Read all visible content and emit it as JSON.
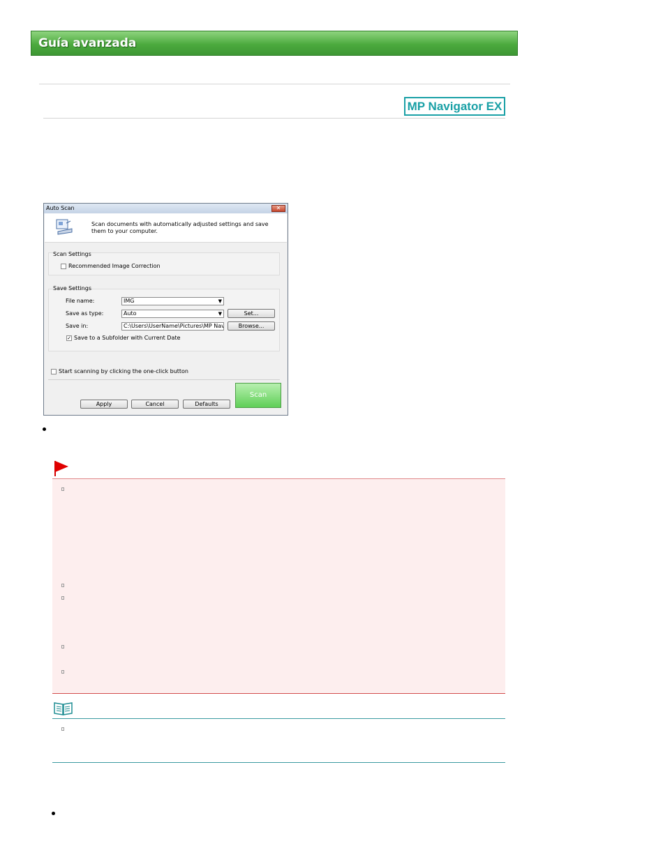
{
  "banner": {
    "title": "Guía avanzada"
  },
  "logo": {
    "text": "MP Navigator EX"
  },
  "dialog": {
    "title": "Auto Scan",
    "close_glyph": "✕",
    "description": "Scan documents with automatically adjusted settings and save them to your computer.",
    "scan_settings": {
      "label": "Scan Settings",
      "recommended_image_correction": {
        "label": "Recommended Image Correction",
        "checked": false
      }
    },
    "save_settings": {
      "label": "Save Settings",
      "file_name_label": "File name:",
      "file_name_value": "IMG",
      "save_as_type_label": "Save as type:",
      "save_as_type_value": "Auto",
      "set_button": "Set...",
      "save_in_label": "Save in:",
      "save_in_value": "C:\\Users\\UserName\\Pictures\\MP Navigato",
      "browse_button": "Browse...",
      "subfolder": {
        "label": "Save to a Subfolder with Current Date",
        "checked": true,
        "mark": "✓"
      }
    },
    "one_click": {
      "label": "Start scanning by clicking the one-click button",
      "checked": false
    },
    "buttons": {
      "apply": "Apply",
      "cancel": "Cancel",
      "defaults": "Defaults",
      "scan": "Scan"
    },
    "dropdown_arrow": "▼"
  },
  "icons": {
    "flag": "important-flag-icon",
    "note": "note-book-icon",
    "bullet": "bullet-icon",
    "list_marker": "square-marker-icon"
  },
  "colors": {
    "banner_green": "#4caa3e",
    "logo_teal": "#19a0a6",
    "important_bg": "#fdeeee",
    "important_red": "#d24b4b",
    "note_teal": "#3a9aa0",
    "scan_green": "#5fcf57"
  }
}
